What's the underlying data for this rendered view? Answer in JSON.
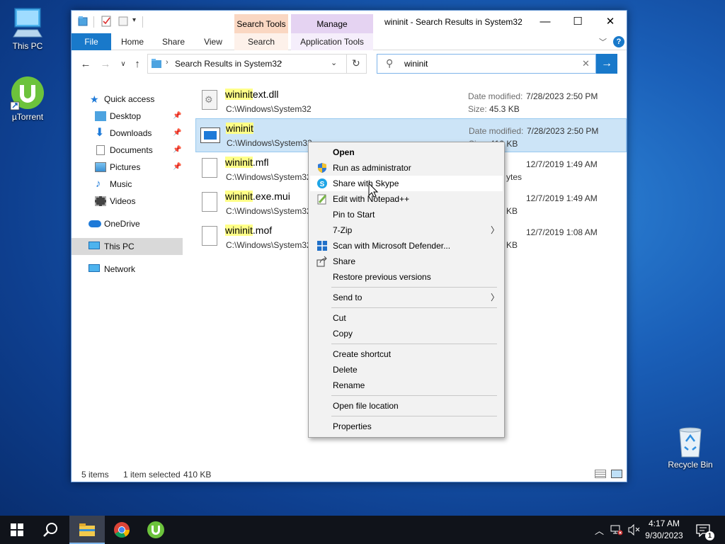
{
  "desktop": {
    "icons": [
      {
        "label": "This PC"
      },
      {
        "label": "µTorrent"
      },
      {
        "label": "Recycle Bin"
      }
    ]
  },
  "window": {
    "title": "wininit - Search Results in System32",
    "context_tabs": {
      "search_tools": "Search Tools",
      "manage": "Manage"
    },
    "ribbon_tabs": [
      "File",
      "Home",
      "Share",
      "View",
      "Search",
      "Application Tools"
    ],
    "address": {
      "path": "Search Results in System32"
    },
    "search": {
      "value": "wininit"
    },
    "nav": [
      {
        "label": "Quick access"
      },
      {
        "label": "Desktop",
        "pinned": true
      },
      {
        "label": "Downloads",
        "pinned": true
      },
      {
        "label": "Documents",
        "pinned": true
      },
      {
        "label": "Pictures",
        "pinned": true
      },
      {
        "label": "Music"
      },
      {
        "label": "Videos"
      },
      {
        "label": "OneDrive"
      },
      {
        "label": "This PC",
        "selected": true
      },
      {
        "label": "Network"
      }
    ],
    "files": [
      {
        "highlight": "wininit",
        "rest": "ext.dll",
        "path": "C:\\Windows\\System32",
        "meta1_label": "Date modified:",
        "meta1": "7/28/2023 2:50 PM",
        "meta2_label": "Size:",
        "meta2": "45.3 KB"
      },
      {
        "highlight": "wininit",
        "rest": "",
        "path": "C:\\Windows\\System32",
        "meta1_label": "Date modified:",
        "meta1": "7/28/2023 2:50 PM",
        "meta2_label": "Size:",
        "meta2": "410 KB",
        "selected": true
      },
      {
        "highlight": "wininit",
        "rest": ".mfl",
        "path": "C:\\Windows\\System32",
        "meta1_label": "",
        "meta1": "12/7/2019 1:49 AM",
        "meta2_label": "",
        "meta2": "ytes"
      },
      {
        "highlight": "wininit",
        "rest": ".exe.mui",
        "path": "C:\\Windows\\System32",
        "meta1_label": "",
        "meta1": "12/7/2019 1:49 AM",
        "meta2_label": "",
        "meta2": "KB"
      },
      {
        "highlight": "wininit",
        "rest": ".mof",
        "path": "C:\\Windows\\System32",
        "meta1_label": "",
        "meta1": "12/7/2019 1:08 AM",
        "meta2_label": "",
        "meta2": "KB"
      }
    ],
    "status": {
      "items": "5 items",
      "selection": "1 item selected",
      "size": "410 KB"
    }
  },
  "context_menu": {
    "items": [
      {
        "label": "Open",
        "bold": true
      },
      {
        "label": "Run as administrator",
        "icon": "shield-icon"
      },
      {
        "label": "Share with Skype",
        "icon": "skype-icon",
        "hover": true
      },
      {
        "label": "Edit with Notepad++",
        "icon": "notepad-plus-plus-icon"
      },
      {
        "label": "Pin to Start"
      },
      {
        "label": "7-Zip",
        "submenu": true
      },
      {
        "label": "Scan with Microsoft Defender...",
        "icon": "defender-icon"
      },
      {
        "label": "Share",
        "icon": "share-icon"
      },
      {
        "label": "Restore previous versions"
      },
      {
        "label": "Send to",
        "submenu": true
      },
      {
        "label": "Cut"
      },
      {
        "label": "Copy"
      },
      {
        "label": "Create shortcut"
      },
      {
        "label": "Delete"
      },
      {
        "label": "Rename"
      },
      {
        "label": "Open file location"
      },
      {
        "label": "Properties"
      }
    ]
  },
  "taskbar": {
    "apps": [
      "file-explorer-icon",
      "chrome-icon",
      "utorrent-icon"
    ],
    "clock": {
      "time": "4:17 AM",
      "date": "9/30/2023"
    },
    "notification_count": "1"
  }
}
